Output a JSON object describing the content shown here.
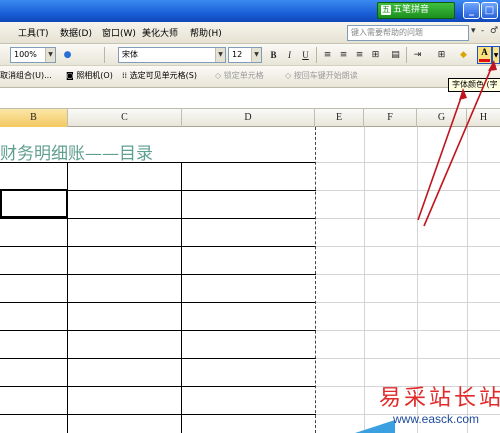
{
  "titlebar": {
    "ime_label": "五笔拼音",
    "buttons": [
      "_",
      "□",
      "×"
    ]
  },
  "menubar": {
    "items": [
      "工具(T)",
      "数据(D)",
      "窗口(W)",
      "美化大师",
      "帮助(H)"
    ],
    "help_placeholder": "键入需要帮助的问题",
    "help_dropdown": "▾",
    "window_controls": [
      "-",
      "♂"
    ]
  },
  "toolbar1": {
    "zoom": "100%",
    "font_name": "宋体",
    "font_size": "12",
    "bold": "B",
    "italic": "I",
    "underline": "U",
    "font_color_btn": "A"
  },
  "toolbar2": {
    "items": [
      {
        "label": "取消组合(U)...",
        "disabled": false
      },
      {
        "label": "照相机(O)",
        "disabled": false
      },
      {
        "label": "选定可见单元格(S)",
        "disabled": false
      },
      {
        "label": "锁定单元格",
        "disabled": true
      },
      {
        "label": "按回车键开始朗读",
        "disabled": true
      }
    ]
  },
  "tooltip": "字体颜色 (字",
  "columns": [
    "B",
    "C",
    "D",
    "E",
    "F",
    "G",
    "H"
  ],
  "selected_column": "B",
  "sheet": {
    "title_text": "财务明细账——目录"
  },
  "watermark": {
    "text": "易采站长站",
    "url": "www.easck.com"
  },
  "colors": {
    "title_green": "#5f9f8f",
    "arrow_red": "#c0141e",
    "tooltip_bg": "#ffffe1",
    "watermark_red": "#e22a2a"
  }
}
